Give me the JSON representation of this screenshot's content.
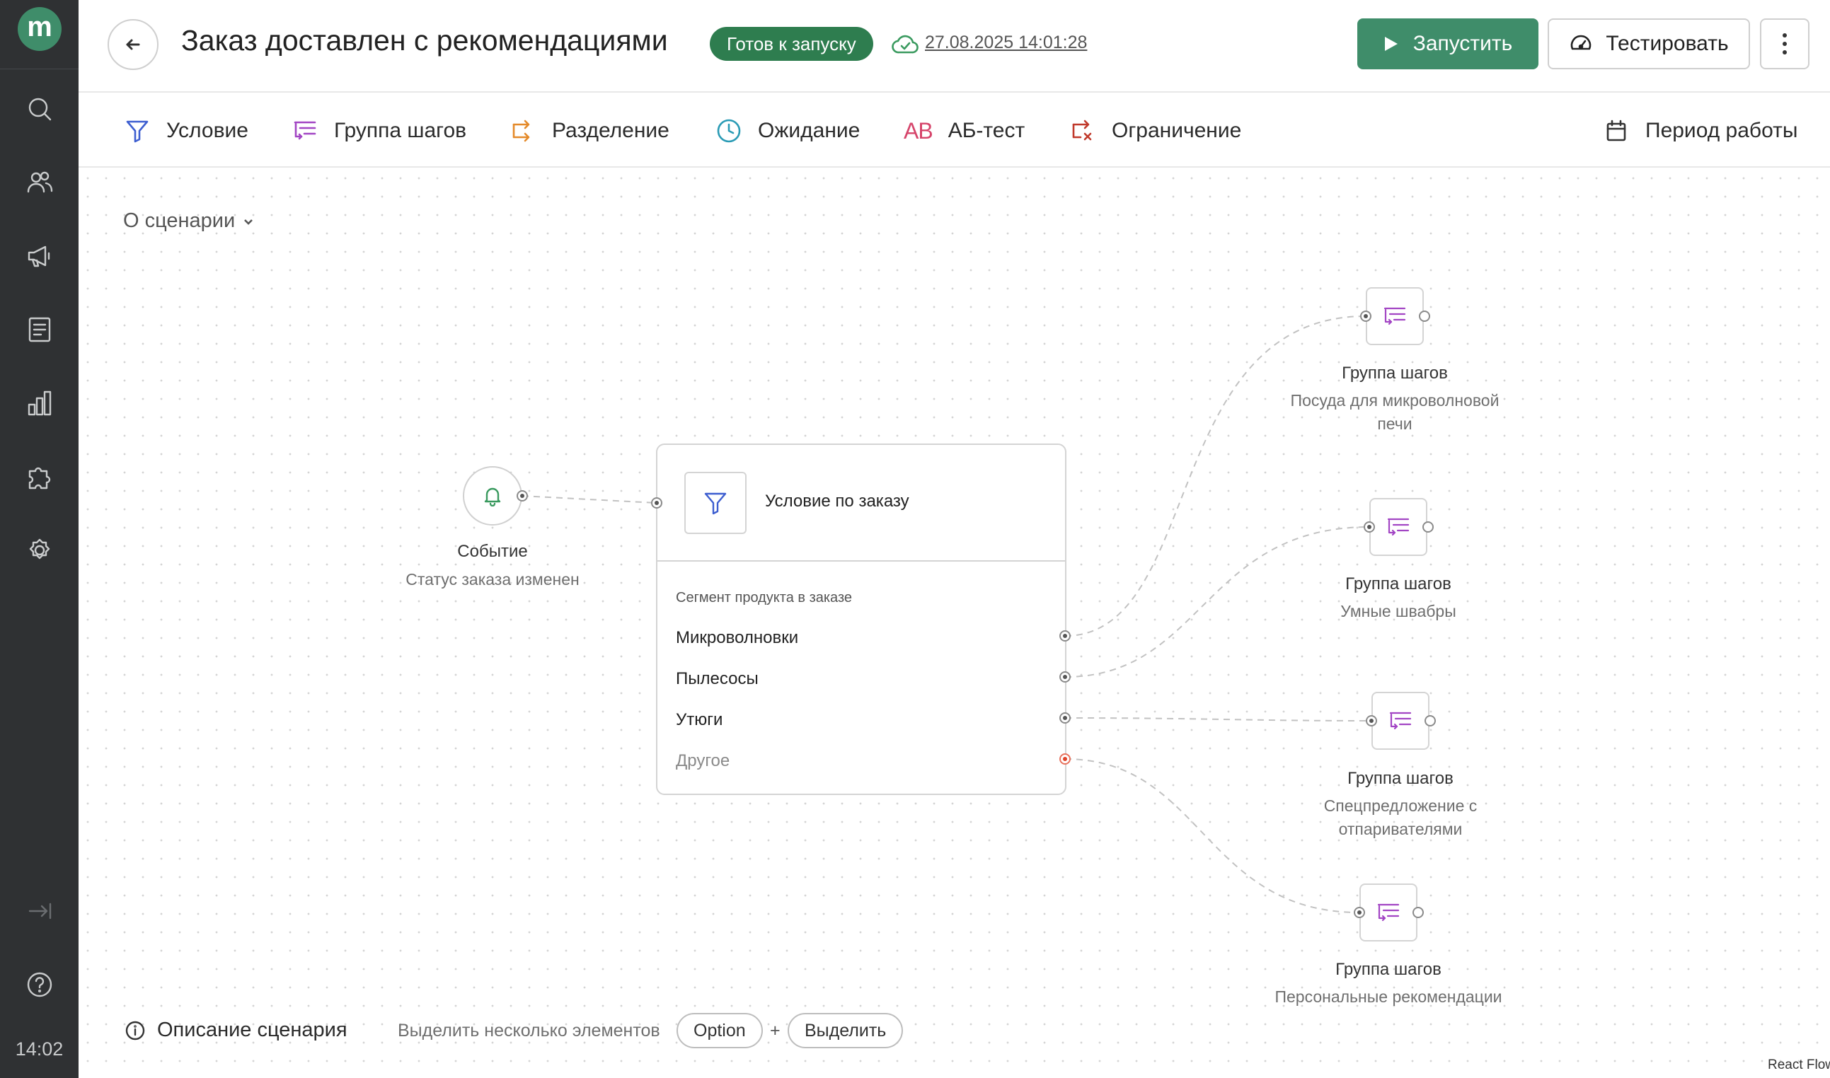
{
  "sidebar": {
    "logo": "m",
    "icons": [
      "search-icon",
      "users-icon",
      "megaphone-icon",
      "document-icon",
      "chart-icon",
      "puzzle-icon",
      "settings-icon",
      "collapse-icon",
      "help-icon"
    ],
    "time": "14:02"
  },
  "header": {
    "title": "Заказ доставлен с рекомендациями",
    "status": "Готов к запуску",
    "saved_at": "27.08.2025 14:01:28",
    "run_label": "Запустить",
    "test_label": "Тестировать"
  },
  "toolbar": {
    "items": [
      {
        "label": "Условие",
        "icon": "filter-icon"
      },
      {
        "label": "Группа шагов",
        "icon": "step-group-icon"
      },
      {
        "label": "Разделение",
        "icon": "split-icon"
      },
      {
        "label": "Ожидание",
        "icon": "clock-icon"
      },
      {
        "label": "АБ-тест",
        "icon": "ab-icon"
      },
      {
        "label": "Ограничение",
        "icon": "limit-icon"
      }
    ],
    "period_label": "Период работы"
  },
  "canvas": {
    "about_label": "О сценарии",
    "event_node": {
      "title": "Событие",
      "subtitle": "Статус заказа изменен"
    },
    "condition_node": {
      "title": "Условие по заказу",
      "segment_label": "Сегмент продукта в заказе",
      "branches": [
        "Микроволновки",
        "Пылесосы",
        "Утюги",
        "Другое"
      ]
    },
    "step_groups": [
      {
        "title": "Группа шагов",
        "subtitle": "Посуда для микроволновой печи"
      },
      {
        "title": "Группа шагов",
        "subtitle": "Умные швабры"
      },
      {
        "title": "Группа шагов",
        "subtitle": "Спецпредложение с отпаривателями"
      },
      {
        "title": "Группа шагов",
        "subtitle": "Персональные рекомендации"
      }
    ]
  },
  "footer": {
    "description_label": "Описание сценария",
    "hint": "Выделить несколько элементов",
    "key1": "Option",
    "plus": "+",
    "key2": "Выделить",
    "attribution": "React Flow"
  },
  "colors": {
    "accent": "#3f8d6a",
    "status": "#2e7d4f",
    "sidebar": "#2f3133",
    "condition_icon": "#3d5ed0",
    "step_group_icon": "#a245c4",
    "ab_icon": "#d6456b"
  }
}
